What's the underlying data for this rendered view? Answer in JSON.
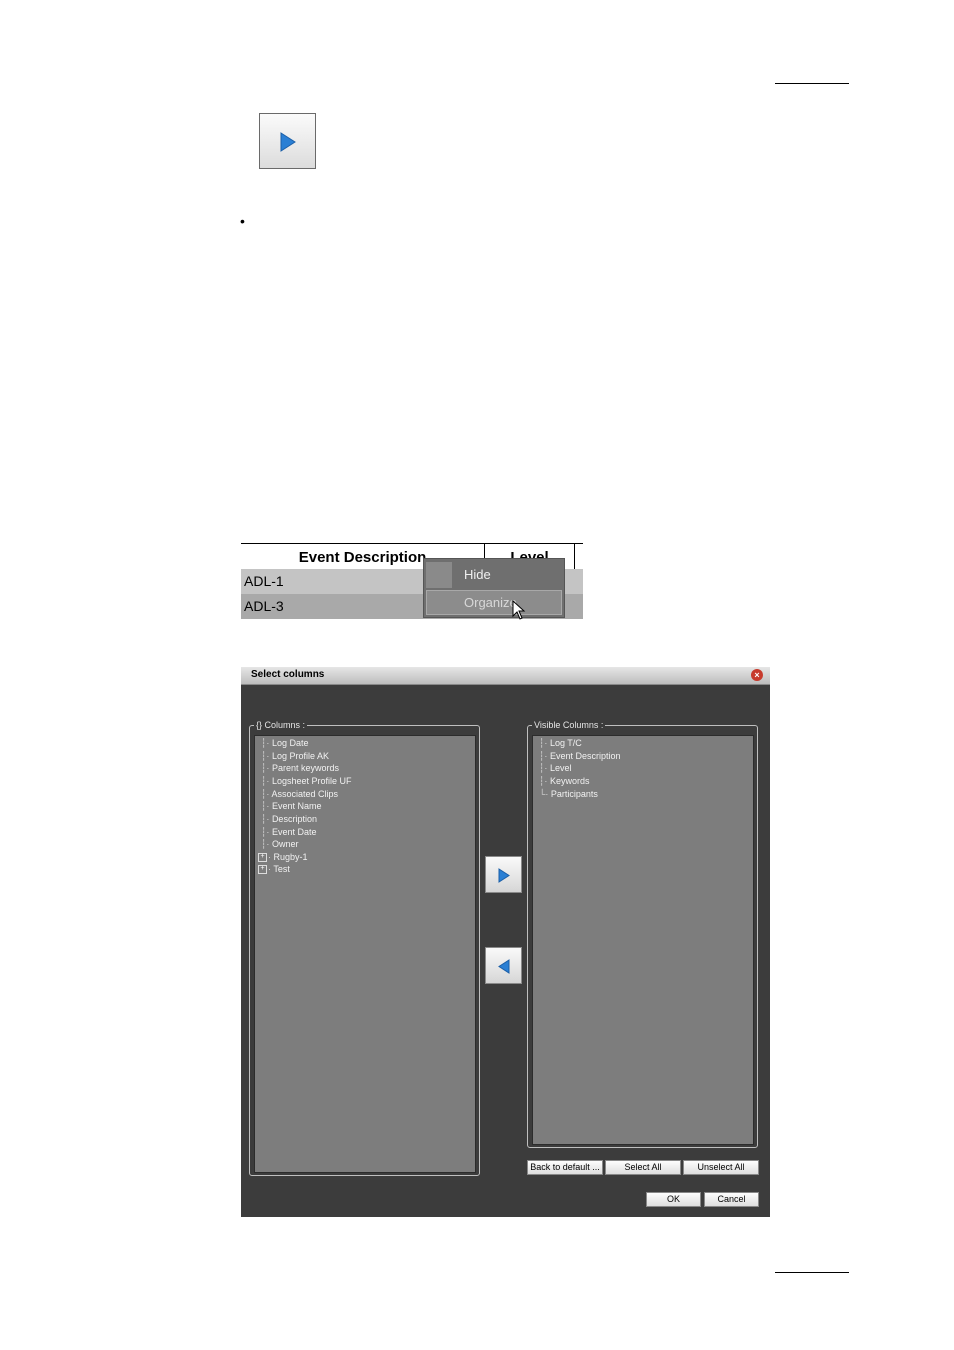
{
  "snippet": {
    "headers": [
      "Event Description",
      "Level"
    ],
    "rows": [
      "ADL-1",
      "ADL-3"
    ],
    "context_menu": [
      "Hide",
      "Organize"
    ]
  },
  "dialog": {
    "title": "Select columns",
    "left_group_label": "{} Columns :",
    "right_group_label": "Visible Columns :",
    "all_columns": [
      "Log Date",
      "Log Profile AK",
      "Parent keywords",
      "Logsheet Profile UF",
      "Associated Clips",
      "Event Name",
      "Description",
      "Event Date",
      "Owner",
      "Rugby-1",
      "Test"
    ],
    "visible_columns": [
      "Log T/C",
      "Event Description",
      "Level",
      "Keywords",
      "Participants"
    ],
    "buttons": {
      "back_to_default": "Back to default ...",
      "select_all": "Select All",
      "unselect_all": "Unselect All",
      "ok": "OK",
      "cancel": "Cancel"
    }
  },
  "colors": {
    "arrow_blue": "#2a7fd4",
    "dialog_bg": "#3c3c3c",
    "list_bg": "#7d7d7d"
  },
  "icons": [
    "play-arrow-icon",
    "mouse-cursor-icon",
    "close-icon",
    "expand-plus-icon",
    "arrow-right-icon",
    "arrow-left-icon"
  ]
}
